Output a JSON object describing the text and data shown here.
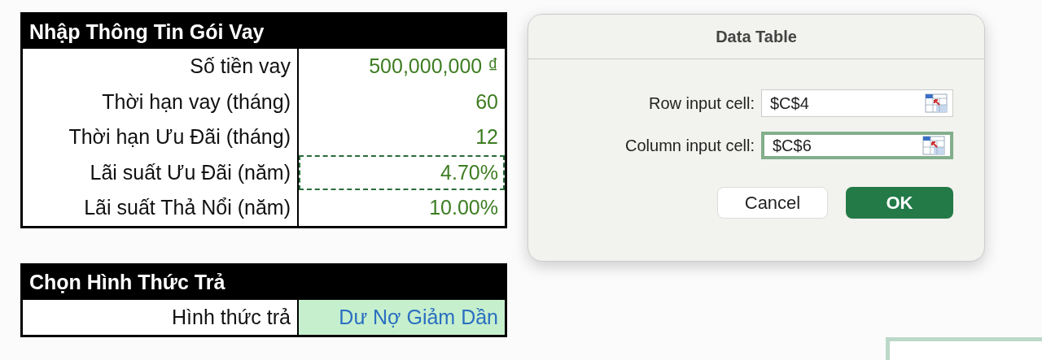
{
  "loan_table": {
    "title": "Nhập Thông Tin Gói Vay",
    "rows": [
      {
        "label": "Số tiền vay",
        "value": "500,000,000 ₫",
        "selected": false
      },
      {
        "label": "Thời hạn vay (tháng)",
        "value": "60",
        "selected": false
      },
      {
        "label": "Thời hạn Ưu Đãi (tháng)",
        "value": "12",
        "selected": false
      },
      {
        "label": "Lãi suất Ưu Đãi (năm)",
        "value": "4.70%",
        "selected": true
      },
      {
        "label": "Lãi suất Thả Nổi (năm)",
        "value": "10.00%",
        "selected": false
      }
    ]
  },
  "payment_table": {
    "title": "Chọn Hình Thức Trả",
    "label": "Hình thức trả",
    "value": "Dư Nợ Giảm Dần"
  },
  "dialog": {
    "title": "Data Table",
    "fields": [
      {
        "label": "Row input cell:",
        "value": "$C$4",
        "focused": false
      },
      {
        "label": "Column input cell:",
        "value": "$C$6",
        "focused": true
      }
    ],
    "buttons": [
      {
        "label": "Cancel",
        "kind": "secondary"
      },
      {
        "label": "OK",
        "kind": "primary"
      }
    ]
  }
}
